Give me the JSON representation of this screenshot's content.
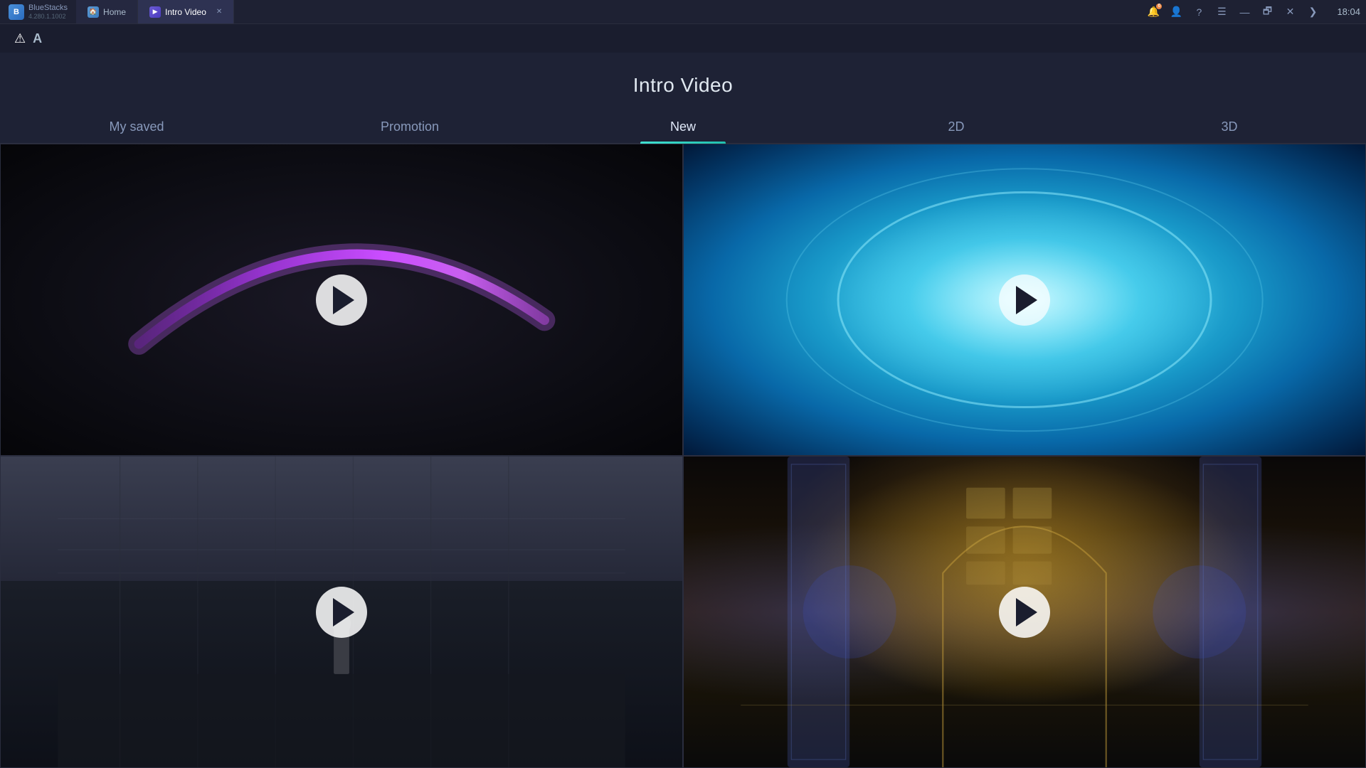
{
  "titlebar": {
    "app_name": "BlueStacks",
    "app_version": "4.280.1.1002",
    "tabs": [
      {
        "label": "Home",
        "icon": "home",
        "active": false
      },
      {
        "label": "Intro Video",
        "icon": "intro",
        "active": true
      }
    ],
    "time": "18:04",
    "buttons": {
      "notification": "🔔",
      "account": "👤",
      "help": "?",
      "menu": "☰",
      "minimize": "—",
      "restore": "🗗",
      "close": "✕",
      "expand": "❯"
    }
  },
  "top_strip": {
    "warning_icon": "⚠",
    "settings_icon": "A"
  },
  "page": {
    "title": "Intro Video",
    "nav_tabs": [
      {
        "label": "My saved",
        "active": false
      },
      {
        "label": "Promotion",
        "active": false
      },
      {
        "label": "New",
        "active": true
      },
      {
        "label": "2D",
        "active": false
      },
      {
        "label": "3D",
        "active": false
      }
    ],
    "videos": [
      {
        "id": 1,
        "description": "Dark video with purple arc"
      },
      {
        "id": 2,
        "description": "Cyan portal glow video"
      },
      {
        "id": 3,
        "description": "Stadium arena video"
      },
      {
        "id": 4,
        "description": "Fantasy hall video"
      }
    ]
  }
}
